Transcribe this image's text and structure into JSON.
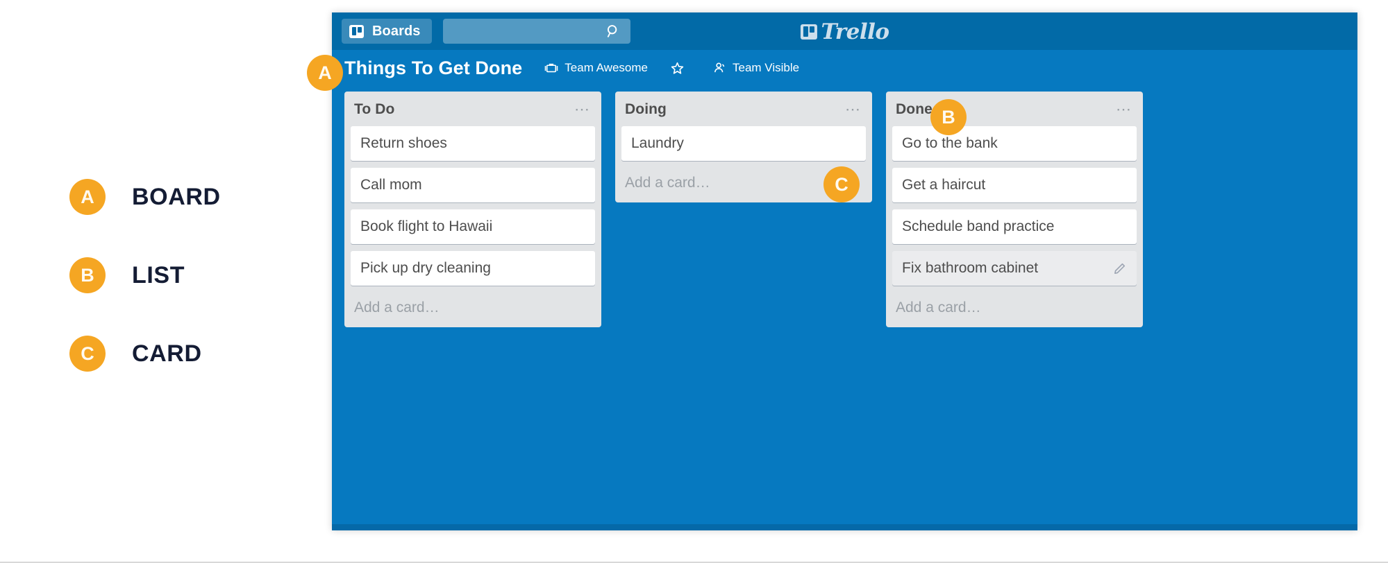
{
  "legend": {
    "items": [
      {
        "badge": "A",
        "label": "BOARD"
      },
      {
        "badge": "B",
        "label": "LIST"
      },
      {
        "badge": "C",
        "label": "CARD"
      }
    ]
  },
  "callouts": [
    {
      "id": "A",
      "target": "board"
    },
    {
      "id": "B",
      "target": "list"
    },
    {
      "id": "C",
      "target": "card"
    }
  ],
  "topbar": {
    "boards_button_label": "Boards",
    "boards_icon": "board-icon",
    "search": {
      "value": "",
      "placeholder": "",
      "icon": "search-icon"
    },
    "logo_text": "Trello",
    "logo_icon": "trello-board-icon"
  },
  "board_header": {
    "title": "Things To Get Done",
    "team": {
      "label": "Team Awesome",
      "icon": "briefcase-icon"
    },
    "star": {
      "label": "",
      "icon": "star-icon"
    },
    "visibility": {
      "label": "Team Visible",
      "icon": "team-visible-icon"
    }
  },
  "lists": [
    {
      "title": "To Do",
      "menu_icon": "ellipsis-icon",
      "cards": [
        {
          "text": "Return shoes",
          "hovered": false
        },
        {
          "text": "Call mom",
          "hovered": false
        },
        {
          "text": "Book flight to Hawaii",
          "hovered": false
        },
        {
          "text": "Pick up dry cleaning",
          "hovered": false
        }
      ],
      "add_card_label": "Add a card…"
    },
    {
      "title": "Doing",
      "menu_icon": "ellipsis-icon",
      "cards": [
        {
          "text": "Laundry",
          "hovered": false
        }
      ],
      "add_card_label": "Add a card…"
    },
    {
      "title": "Done",
      "menu_icon": "ellipsis-icon",
      "cards": [
        {
          "text": "Go to the bank",
          "hovered": false
        },
        {
          "text": "Get a haircut",
          "hovered": false
        },
        {
          "text": "Schedule band practice",
          "hovered": false
        },
        {
          "text": "Fix bathroom cabinet",
          "hovered": true,
          "edit_icon": "pencil-icon"
        }
      ],
      "add_card_label": "Add a card…"
    }
  ],
  "colors": {
    "brand_blue": "#0679c0",
    "topbar_blue": "#026aa7",
    "list_grey": "#e2e4e6",
    "card_white": "#ffffff",
    "accent_orange": "#f5a623",
    "legend_text": "#141c34"
  }
}
